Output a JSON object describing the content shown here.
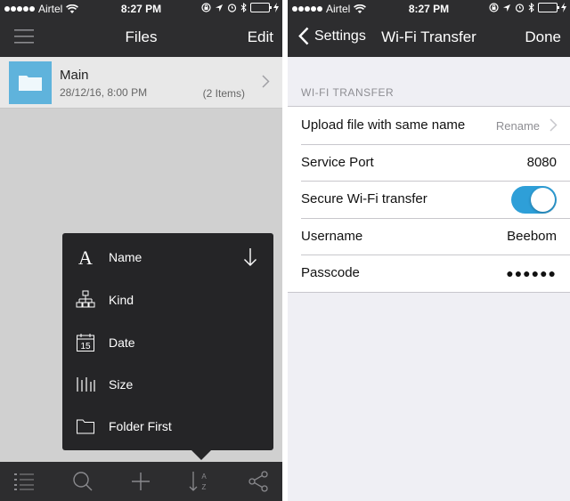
{
  "status_bar": {
    "carrier": "Airtel",
    "time": "8:27 PM"
  },
  "files_screen": {
    "nav": {
      "title": "Files",
      "edit_label": "Edit",
      "menu_icon": "hamburger-icon"
    },
    "folders": [
      {
        "name": "Main",
        "date": "28/12/16, 8:00 PM",
        "count": "(2 Items)"
      }
    ],
    "sort_menu": {
      "items": [
        {
          "label": "Name",
          "icon": "letter-a-icon",
          "sort_direction": "down-arrow-icon"
        },
        {
          "label": "Kind",
          "icon": "hierarchy-icon"
        },
        {
          "label": "Date",
          "icon": "calendar-icon",
          "icon_text": "15"
        },
        {
          "label": "Size",
          "icon": "bars-icon"
        },
        {
          "label": "Folder First",
          "icon": "folder-icon"
        }
      ]
    },
    "toolbar": {
      "buttons": [
        "list-icon",
        "search-icon",
        "plus-icon",
        "sort-az-icon",
        "share-icon"
      ],
      "sort_letters": {
        "a": "A",
        "z": "Z"
      }
    }
  },
  "wifi_screen": {
    "nav": {
      "back_label": "Settings",
      "title": "Wi-Fi Transfer",
      "done_label": "Done"
    },
    "section_header": "WI-FI TRANSFER",
    "rows": [
      {
        "label": "Upload file with same name",
        "value": "Rename"
      },
      {
        "label": "Service Port",
        "value": "8080"
      },
      {
        "label": "Secure Wi-Fi transfer",
        "toggle_on": true
      },
      {
        "label": "Username",
        "value": "Beebom"
      },
      {
        "label": "Passcode",
        "value": "●●●●●●"
      }
    ]
  },
  "colors": {
    "bar": "#2d2d2f",
    "popover": "#252527",
    "folder": "#5fb3dc",
    "toggle_on": "#2e9fd8",
    "battery": "#4cd964"
  }
}
